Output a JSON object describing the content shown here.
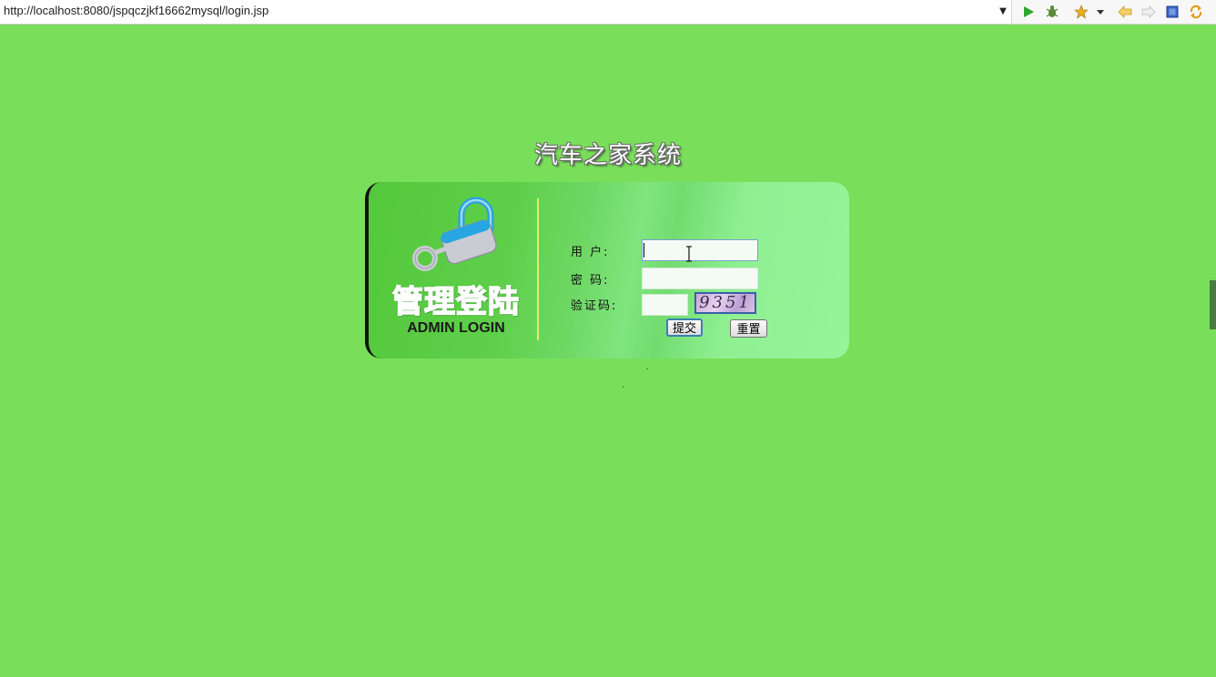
{
  "browser": {
    "url": "http://localhost:8080/jspqczjkf16662mysql/login.jsp",
    "toolbar_icons": [
      "run-icon",
      "debug-icon",
      "favorite-icon",
      "menu-dropdown-icon",
      "back-icon",
      "forward-icon",
      "stop-icon",
      "refresh-icon"
    ]
  },
  "page": {
    "title": "汽车之家系统",
    "background_color": "#79df5a"
  },
  "login_panel": {
    "heading_cn": "管理登陆",
    "heading_en": "ADMIN LOGIN",
    "username_label": "用 户:",
    "password_label": "密 码:",
    "captcha_label": "验证码:",
    "username_value": "",
    "password_value": "",
    "captcha_value": "",
    "captcha_code": "9351",
    "submit_label": "提交",
    "reset_label": "重置"
  }
}
